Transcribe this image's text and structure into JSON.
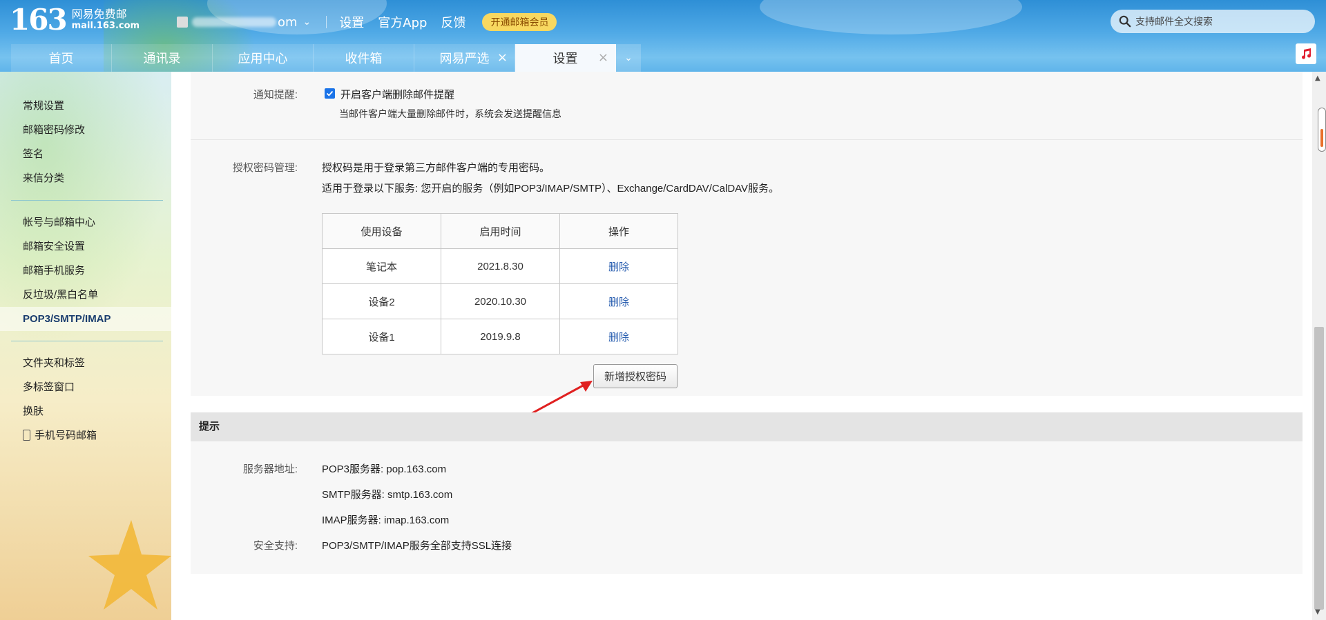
{
  "header": {
    "logo_number": "163",
    "logo_cn": "网易免费邮",
    "logo_domain": "mail.163.com",
    "account_suffix": "om",
    "links": [
      "设置",
      "官方App",
      "反馈"
    ],
    "vip_label": "开通邮箱会员",
    "search_placeholder": "支持邮件全文搜索"
  },
  "tabs": [
    {
      "label": "首页",
      "closable": false
    },
    {
      "label": "通讯录",
      "closable": false
    },
    {
      "label": "应用中心",
      "closable": false
    },
    {
      "label": "收件箱",
      "closable": false
    },
    {
      "label": "网易严选",
      "closable": true
    },
    {
      "label": "设置",
      "closable": true,
      "active": true
    }
  ],
  "sidebar": {
    "group1": [
      "常规设置",
      "邮箱密码修改",
      "签名",
      "来信分类"
    ],
    "group2": [
      "帐号与邮箱中心",
      "邮箱安全设置",
      "邮箱手机服务",
      "反垃圾/黑白名单",
      "POP3/SMTP/IMAP"
    ],
    "group3": [
      "文件夹和标签",
      "多标签窗口",
      "换肤",
      "手机号码邮箱"
    ],
    "active": "POP3/SMTP/IMAP"
  },
  "notify": {
    "label": "通知提醒:",
    "checkbox_label": "开启客户端删除邮件提醒",
    "checked": true,
    "hint": "当邮件客户端大量删除邮件时，系统会发送提醒信息"
  },
  "auth": {
    "label": "授权密码管理:",
    "desc1": "授权码是用于登录第三方邮件客户端的专用密码。",
    "desc2": "适用于登录以下服务: 您开启的服务（例如POP3/IMAP/SMTP）、Exchange/CardDAV/CalDAV服务。",
    "columns": [
      "使用设备",
      "启用时间",
      "操作"
    ],
    "rows": [
      {
        "device": "笔记本",
        "date": "2021.8.30",
        "action": "删除"
      },
      {
        "device": "设备2",
        "date": "2020.10.30",
        "action": "删除"
      },
      {
        "device": "设备1",
        "date": "2019.9.8",
        "action": "删除"
      }
    ],
    "add_button": "新增授权密码"
  },
  "tips": {
    "title": "提示",
    "server_label": "服务器地址:",
    "pop3": "POP3服务器: pop.163.com",
    "smtp": "SMTP服务器: smtp.163.com",
    "imap": "IMAP服务器: imap.163.com",
    "security_label": "安全支持:",
    "security_text": "POP3/SMTP/IMAP服务全部支持SSL连接"
  },
  "colors": {
    "accent": "#2e8fd6",
    "arrow": "#e02020",
    "link": "#2a5fb0"
  }
}
